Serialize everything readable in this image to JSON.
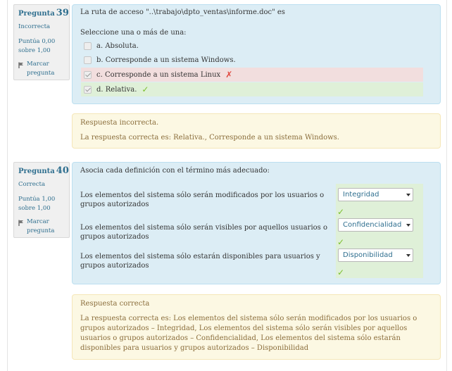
{
  "q39": {
    "label": "Pregunta",
    "number": "39",
    "state": "Incorrecta",
    "grade_line1": "Puntúa 0,00",
    "grade_line2": "sobre 1,00",
    "flag_line1": "Marcar",
    "flag_line2": "pregunta",
    "question": "La ruta de acceso \"..\\trabajo\\dpto_ventas\\informe.doc\" es",
    "prompt": "Seleccione una o más de una:",
    "answers": [
      {
        "text": "a. Absoluta.",
        "checked": false,
        "status": "none"
      },
      {
        "text": "b. Corresponde a un sistema Windows.",
        "checked": false,
        "status": "none"
      },
      {
        "text": "c. Corresponde a un sistema Linux",
        "checked": true,
        "status": "incorrect"
      },
      {
        "text": "d. Relativa.",
        "checked": true,
        "status": "correct"
      }
    ],
    "feedback": "Respuesta incorrecta.",
    "right_answer": "La respuesta correcta es: Relativa., Corresponde a un sistema Windows."
  },
  "q40": {
    "label": "Pregunta",
    "number": "40",
    "state": "Correcta",
    "grade_line1": "Puntúa 1,00",
    "grade_line2": "sobre 1,00",
    "flag_line1": "Marcar",
    "flag_line2": "pregunta",
    "question": "Asocia cada definición con el término más adecuado:",
    "rows": [
      {
        "line1": "Los elementos del sistema sólo serán modificados por los usuarios o",
        "line2": "grupos autorizados",
        "selected": "Integridad"
      },
      {
        "line1": "Los elementos del sistema sólo serán visibles por aquellos usuarios o",
        "line2": "grupos autorizados",
        "selected": "Confidencialidad"
      },
      {
        "line1": "Los elementos del sistema sólo estarán disponibles para usuarios y",
        "line2": "grupos autorizados",
        "selected": "Disponibilidad"
      }
    ],
    "feedback": "Respuesta correcta",
    "right_answer": "La respuesta correcta es: Los elementos del sistema sólo serán modificados por los usuarios o grupos autorizados – Integridad, Los elementos del sistema sólo serán visibles por aquellos usuarios o grupos autorizados – Confidencialidad, Los elementos del sistema sólo estarán disponibles para usuarios y grupos autorizados – Disponibilidad"
  },
  "colors": {
    "accent": "#2f6f8f",
    "incorrect": "#e0463c",
    "correct": "#7bbf2e"
  }
}
